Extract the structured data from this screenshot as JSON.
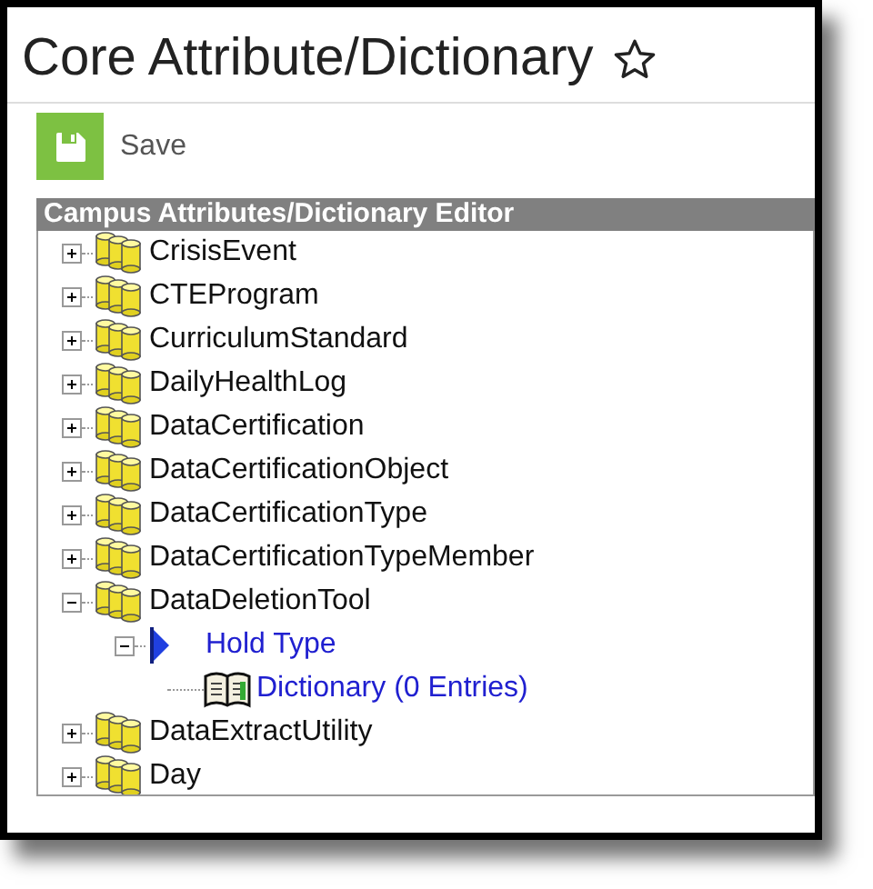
{
  "page": {
    "title": "Core Attribute/Dictionary",
    "favorite": false
  },
  "toolbar": {
    "save_label": "Save"
  },
  "panel": {
    "title": "Campus Attributes/Dictionary Editor"
  },
  "tree": [
    {
      "kind": "table",
      "label": "CrisisEvent",
      "expanded": false
    },
    {
      "kind": "table",
      "label": "CTEProgram",
      "expanded": false
    },
    {
      "kind": "table",
      "label": "CurriculumStandard",
      "expanded": false
    },
    {
      "kind": "table",
      "label": "DailyHealthLog",
      "expanded": false
    },
    {
      "kind": "table",
      "label": "DataCertification",
      "expanded": false
    },
    {
      "kind": "table",
      "label": "DataCertificationObject",
      "expanded": false
    },
    {
      "kind": "table",
      "label": "DataCertificationType",
      "expanded": false
    },
    {
      "kind": "table",
      "label": "DataCertificationTypeMember",
      "expanded": false
    },
    {
      "kind": "table",
      "label": "DataDeletionTool",
      "expanded": true,
      "children": [
        {
          "kind": "attribute",
          "label": "Hold Type",
          "expanded": true,
          "children": [
            {
              "kind": "dictionary",
              "label": "Dictionary (0 Entries)"
            }
          ]
        }
      ]
    },
    {
      "kind": "table",
      "label": "DataExtractUtility",
      "expanded": false
    },
    {
      "kind": "table",
      "label": "Day",
      "expanded": false
    }
  ]
}
